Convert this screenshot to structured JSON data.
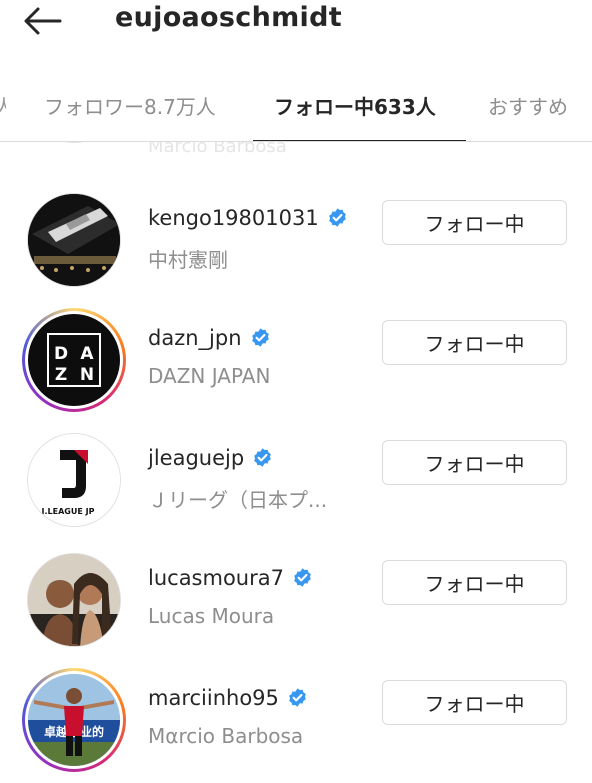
{
  "header": {
    "username": "eujoaoschmidt"
  },
  "tabs": {
    "previous": "人",
    "followers": "フォロワー8.7万人",
    "following": "フォロー中633人",
    "suggested": "おすすめ"
  },
  "partial_row": {
    "fullname": "Marcio Barbosa"
  },
  "accounts": [
    {
      "username": "kengo19801031",
      "fullname": "中村憲剛",
      "verified": true,
      "button": "フォロー中"
    },
    {
      "username": "dazn_jpn",
      "fullname": "DAZN JAPAN",
      "verified": true,
      "button": "フォロー中"
    },
    {
      "username": "jleaguejp",
      "fullname": "Ｊリーグ（日本プ...",
      "verified": true,
      "button": "フォロー中"
    },
    {
      "username": "lucasmoura7",
      "fullname": "Lucas Moura",
      "verified": true,
      "button": "フォロー中"
    },
    {
      "username": "marciinho95",
      "fullname": "Mαrcio Barbosa",
      "verified": true,
      "button": "フォロー中"
    }
  ],
  "avatar_text": {
    "dazn_logo": [
      "D",
      "A",
      "Z",
      "N"
    ],
    "jleague_logo": "J.LEAGUE JP",
    "banner_text": "卓越企业的"
  },
  "colors": {
    "verified_blue": "#3897f0",
    "button_border": "#dbdbdb",
    "secondary_text": "#8e8e8e"
  }
}
